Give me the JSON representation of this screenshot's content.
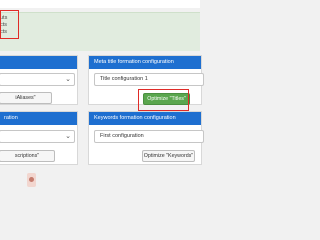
{
  "alert": {
    "lines": [
      "uts",
      "cts",
      "cts"
    ]
  },
  "panels": {
    "left_top": {
      "button_label": "iAliases\""
    },
    "meta_title": {
      "header": "Meta title formation configuration",
      "select_value": "Title configuration 1",
      "button_label": "Optimize \"Titles\""
    },
    "left_bottom": {
      "header": "ration",
      "button_label": "scriptions\""
    },
    "keywords": {
      "header": "Keywords formation configuration",
      "select_value": "First configuration",
      "button_label": "Optimize \"Keywords\""
    }
  },
  "colors": {
    "header_blue": "#1e6fd0",
    "alert_green": "#e1ecdf",
    "optimize_green": "#5aa64e",
    "highlight_red": "#e02b27"
  }
}
